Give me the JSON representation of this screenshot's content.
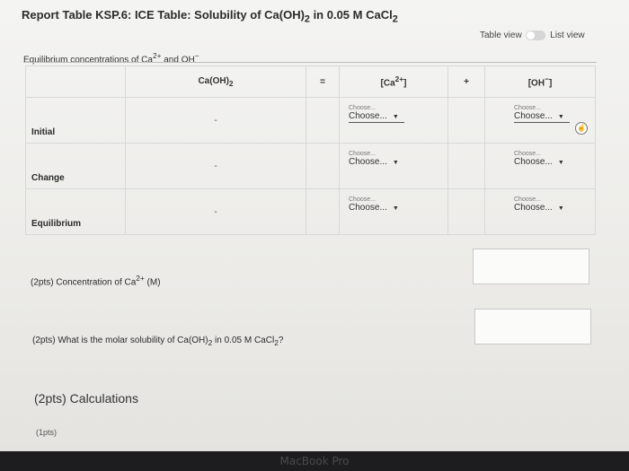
{
  "title": "Report Table KSP.6: ICE Table: Solubility of Ca(OH)",
  "title_sub": "2",
  "title_rest": " in 0.05 M CaCl",
  "title_sub2": "2",
  "view_toggle": {
    "left": "Table view",
    "right": "List view"
  },
  "section_label": "Equilibrium concentrations of Ca",
  "section_label_sup": "2+",
  "section_label_rest": " and OH",
  "section_label_sup2": "−",
  "table": {
    "headers": [
      "Ca(OH)",
      "=",
      "[Ca",
      "+",
      "[OH"
    ],
    "header_subs": [
      "2"
    ],
    "header_sups": [
      "2+",
      "−"
    ],
    "header_close": [
      "]",
      "]"
    ],
    "rows": [
      {
        "label": "Initial",
        "caoh2": "-",
        "ca_small": "Choose...",
        "ca_value": "Choose...",
        "oh_small": "Choose...",
        "oh_value": "Choose..."
      },
      {
        "label": "Change",
        "caoh2": "-",
        "ca_small": "Choose...",
        "ca_value": "Choose...",
        "oh_small": "Choose...",
        "oh_value": "Choose..."
      },
      {
        "label": "Equilibrium",
        "caoh2": "-",
        "ca_small": "Choose...",
        "ca_value": "Choose...",
        "oh_small": "Choose...",
        "oh_value": "Choose..."
      }
    ]
  },
  "questions": {
    "q1": "(2pts)  Concentration of Ca",
    "q1_sup": "2+",
    "q1_rest": " (M)",
    "q2": "(2pts)  What is the molar solubility of Ca(OH)",
    "q2_sub": "2",
    "q2_mid": " in 0.05 M CaCl",
    "q2_sub2": "2",
    "q2_end": "?",
    "q3": "(2pts) Calculations",
    "q4": "(1pts)"
  },
  "bezel_label": "MacBook Pro"
}
